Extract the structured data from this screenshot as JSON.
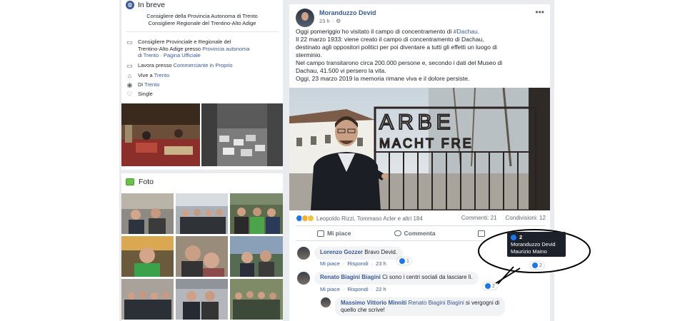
{
  "intro": {
    "title": "In breve",
    "bio_lines": [
      "Consigliere della Provincia Autonoma di Trento",
      "Consigliere Regionale del Trentino-Alto Adige"
    ],
    "role_line1": "Consigliere Provinciale e Regionale del",
    "role_line2_prefix": "Trentino-Alto Adige presso ",
    "role_link1": "Provincia autonoma",
    "role_link2": "di Trento · Pagina Ufficiale",
    "work_prefix": "Lavora presso ",
    "work_link": "Commerciante in Proprio",
    "lives_prefix": "Vive a ",
    "lives_link": "Trento",
    "from_prefix": "Di ",
    "from_link": "Trento",
    "status": "Single"
  },
  "photos": {
    "title": "Foto"
  },
  "post": {
    "author": "Moranduzzo Devid",
    "time": "23 h",
    "text_lines": [
      "Oggi pomeriggio ho visitato il campo di concentramento di ",
      "Il 22 marzo 1933: viene creato il campo di concentramento di Dachau,",
      "destinato agli oppositori politici per poi diventare a tutti gli effetti un luogo di",
      "sterminio.",
      "Nel campo transitarono circa 200.000 persone e, secondo i dati del Museo di",
      "Dachau, 41.500 vi persero la vita.",
      "Oggi, 23 marzo 2019 la memoria rimane viva e il dolore persiste."
    ],
    "hashtag": "#Dachau.",
    "gate_text": [
      "ARBE",
      "MACHT FRE"
    ],
    "reactions_text": "Leopoldo Rizzi, Tommaso Acler e altri 184",
    "comments_count": "Commenti: 21",
    "shares_count": "Condivisioni: 12",
    "like_label": "Mi piace",
    "comment_label": "Commenta"
  },
  "comments": [
    {
      "name": "Lorenzo Gozzer",
      "text": " Bravo Devid.",
      "like": "Mi piace",
      "reply": "Rispondi",
      "time": "23 h",
      "reactions": "1"
    },
    {
      "name": "Renato Biagini Biagini",
      "text": " Ci sono i centri sociali da lasciare lì.",
      "like": "Mi piace",
      "reply": "Rispondi",
      "time": "22 h",
      "reactions": "2"
    },
    {
      "name": "Massimo Vittorio Minniti",
      "mention": "Renato Biagini Biagini",
      "text1": " si vergogni di",
      "text2": "quello che scrive!"
    }
  ],
  "tooltip": {
    "count": "2",
    "names": [
      "Moranduzzo Devid",
      "Maurizio Maino"
    ],
    "badge_count": "2"
  },
  "colors": {
    "link": "#385898",
    "like_blue": "#1877f2",
    "page_bg": "#e9ebee"
  }
}
